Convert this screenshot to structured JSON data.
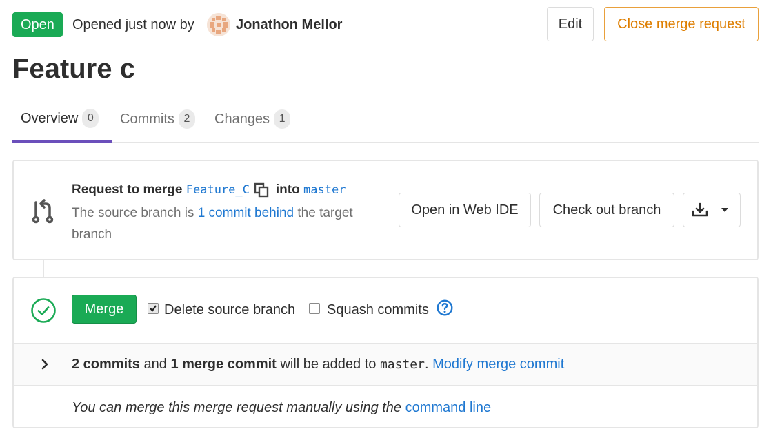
{
  "header": {
    "status": "Open",
    "opened_text": "Opened just now by",
    "author": "Jonathon Mellor",
    "edit_label": "Edit",
    "close_label": "Close merge request"
  },
  "title": "Feature c",
  "tabs": [
    {
      "label": "Overview",
      "count": "0",
      "active": true
    },
    {
      "label": "Commits",
      "count": "2",
      "active": false
    },
    {
      "label": "Changes",
      "count": "1",
      "active": false
    }
  ],
  "merge_info": {
    "request_prefix": "Request to merge",
    "source_branch": "Feature_C",
    "into_label": "into",
    "target_branch": "master",
    "behind_prefix": "The source branch is",
    "behind_link": "1 commit behind",
    "behind_suffix": "the target branch",
    "web_ide_label": "Open in Web IDE",
    "checkout_label": "Check out branch"
  },
  "merge_widget": {
    "merge_label": "Merge",
    "delete_source_label": "Delete source branch",
    "delete_source_checked": true,
    "squash_label": "Squash commits",
    "squash_checked": false,
    "commits_count": "2 commits",
    "and_text": "and",
    "merge_commit_count": "1 merge commit",
    "added_text": "will be added to",
    "target_branch": "master",
    "period": ".",
    "modify_link": "Modify merge commit",
    "manual_text": "You can merge this merge request manually using the",
    "manual_link": "command line"
  },
  "colors": {
    "open_green": "#1aaa55",
    "close_orange": "#de7e00",
    "link_blue": "#1f78d1",
    "tab_active": "#6b4fbb"
  }
}
